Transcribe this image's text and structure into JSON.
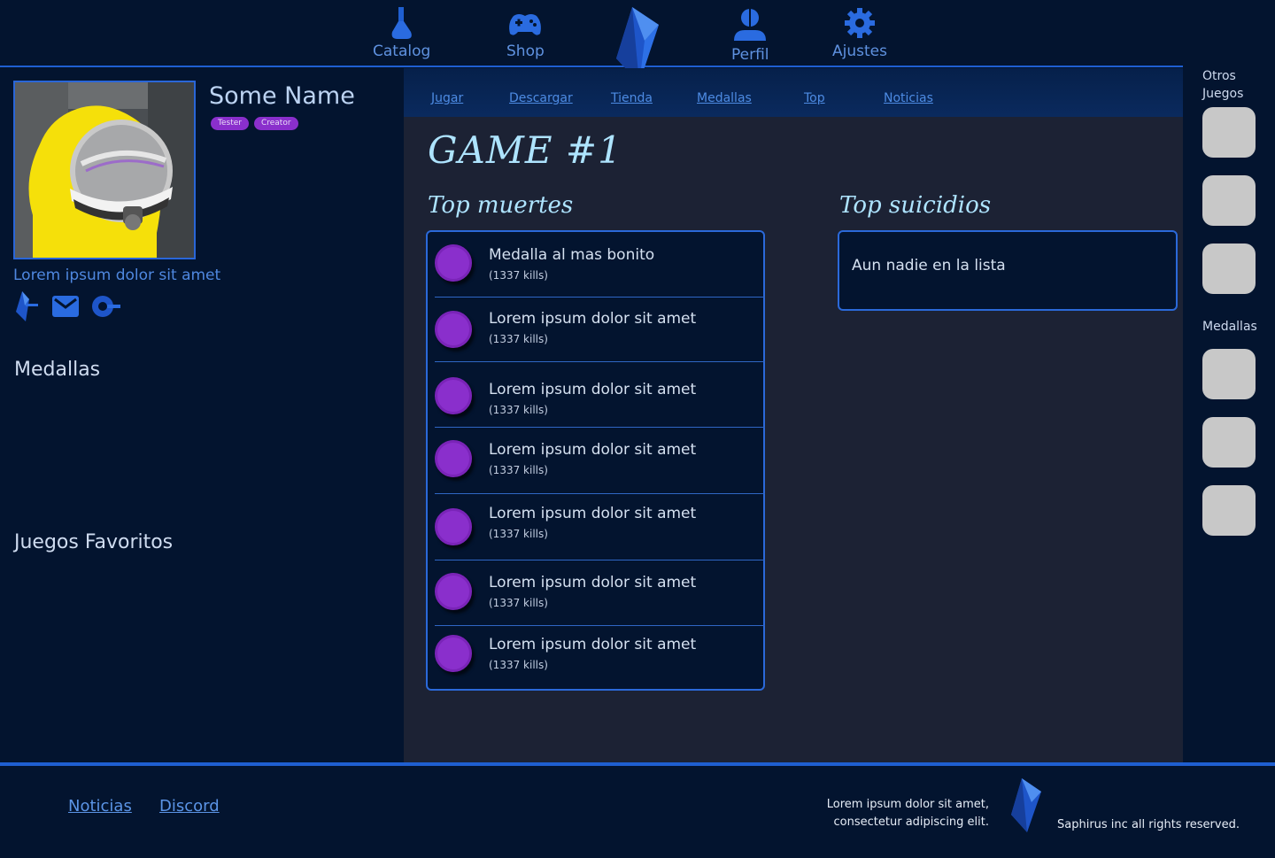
{
  "topnav": {
    "items": [
      {
        "label": "Catalog",
        "icon": "flask-icon"
      },
      {
        "label": "Shop",
        "icon": "gamepad-icon"
      },
      {
        "label": "Perfil",
        "icon": "user-icon"
      },
      {
        "label": "Ajustes",
        "icon": "gear-icon"
      }
    ],
    "logo_icon": "sapphire-gem-icon"
  },
  "profile": {
    "name": "Some Name",
    "badges": [
      "Tester",
      "Creator"
    ],
    "bio": "Lorem ipsum dolor sit amet",
    "social_icons": [
      "sapphire-gem-icon",
      "mail-icon",
      "link-icon"
    ]
  },
  "sections": {
    "medallas": "Medallas",
    "favoritos": "Juegos Favoritos"
  },
  "subnav": {
    "links": [
      "Jugar",
      "Descargar",
      "Tienda",
      "Medallas",
      "Top",
      "Noticias"
    ]
  },
  "game": {
    "title": "GAME #1",
    "top_muertes_title": "Top muertes",
    "top_suicidios_title": "Top suicidios",
    "top_muertes": [
      {
        "title": "Medalla al mas bonito",
        "sub": "(1337 kills)"
      },
      {
        "title": "Lorem ipsum dolor sit amet",
        "sub": "(1337 kills)"
      },
      {
        "title": "Lorem ipsum dolor sit amet",
        "sub": "(1337 kills)"
      },
      {
        "title": "Lorem ipsum dolor sit amet",
        "sub": "(1337 kills)"
      },
      {
        "title": "Lorem ipsum dolor sit amet",
        "sub": "(1337 kills)"
      },
      {
        "title": "Lorem ipsum dolor sit amet",
        "sub": "(1337 kills)"
      },
      {
        "title": "Lorem ipsum dolor sit amet",
        "sub": "(1337 kills)"
      }
    ],
    "top_suicidios_empty": "Aun nadie en la lista"
  },
  "sidebar": {
    "otros_juegos": "Otros Juegos",
    "medallas": "Medallas"
  },
  "footer": {
    "links": [
      "Noticias",
      "Discord"
    ],
    "text": "Lorem ipsum dolor sit amet, consectetur adipiscing elit.",
    "copyright": "Saphirus inc all rights reserved."
  },
  "colors": {
    "background": "#03142f",
    "panel": "#1c2234",
    "accent": "#1f5fd1",
    "medal": "#8a2fcc",
    "title": "#aee4ff"
  }
}
